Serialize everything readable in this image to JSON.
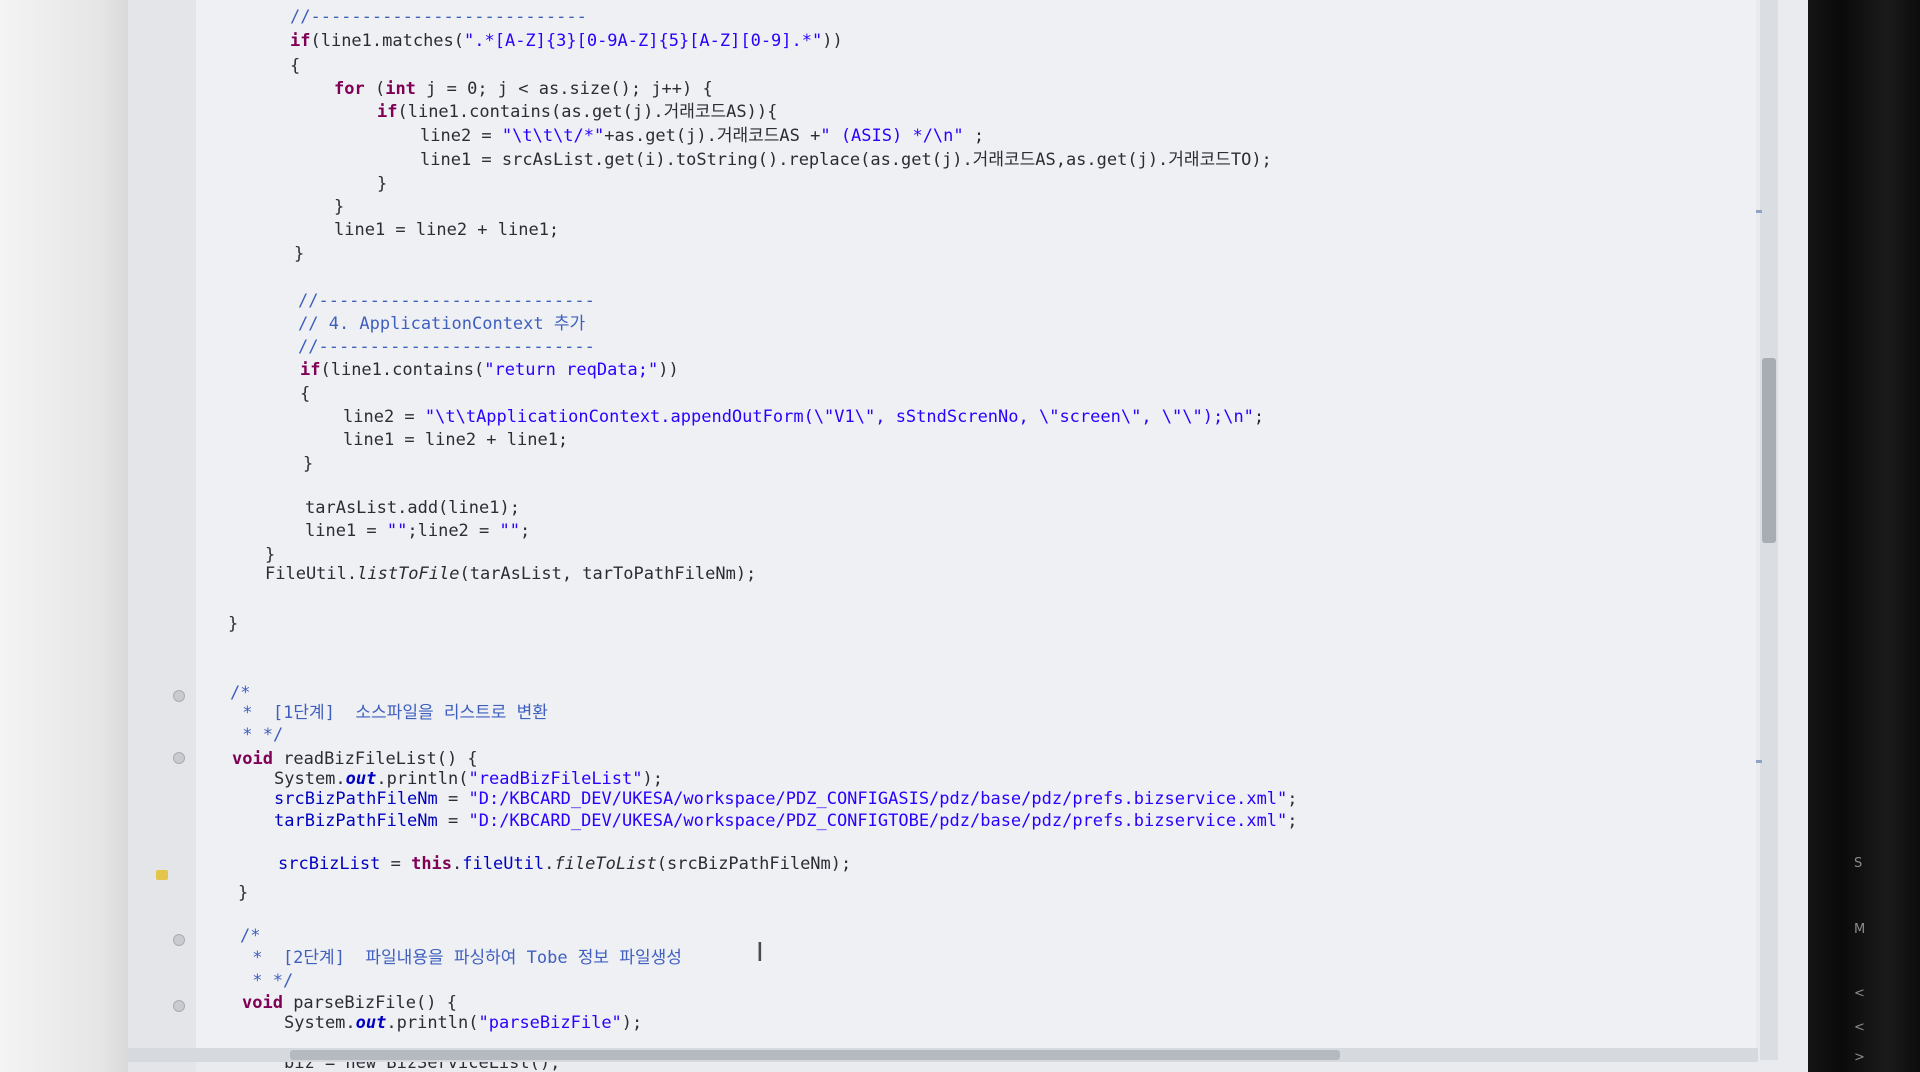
{
  "editor": {
    "lines": [
      {
        "id": "l1",
        "text": "//---------------------------"
      },
      {
        "id": "l2",
        "text": "if(line1.matches(\".*[A-Z]{3}[0-9A-Z]{5}[A-Z][0-9].*\"))"
      },
      {
        "id": "l3",
        "text": "{"
      },
      {
        "id": "l4",
        "text": "for (int j = 0; j < as.size(); j++) {"
      },
      {
        "id": "l5",
        "text": "if(line1.contains(as.get(j).거래코드AS)){"
      },
      {
        "id": "l6",
        "text": "line2 = \"\\t\\t\\t/*\"+as.get(j).거래코드AS +\" (ASIS) */\\n\" ;"
      },
      {
        "id": "l7",
        "text": "line1 = srcAsList.get(i).toString().replace(as.get(j).거래코드AS,as.get(j).거래코드TO);"
      },
      {
        "id": "l8",
        "text": "}"
      },
      {
        "id": "l9",
        "text": "}"
      },
      {
        "id": "l10",
        "text": "line1 = line2 + line1;"
      },
      {
        "id": "l11",
        "text": "}"
      },
      {
        "id": "l12",
        "text": "//---------------------------"
      },
      {
        "id": "l13",
        "text": "// 4. ApplicationContext 추가"
      },
      {
        "id": "l14",
        "text": "//---------------------------"
      },
      {
        "id": "l15",
        "text": "if(line1.contains(\"return reqData;\"))"
      },
      {
        "id": "l16",
        "text": "{"
      },
      {
        "id": "l17",
        "text": "line2 = \"\\t\\tApplicationContext.appendOutForm(\\\"V1\\\", sStndScrenNo, \\\"screen\\\", \\\"\\\");\\n\";"
      },
      {
        "id": "l18",
        "text": "line1 = line2 + line1;"
      },
      {
        "id": "l19",
        "text": "}"
      },
      {
        "id": "l20",
        "text": "tarAsList.add(line1);"
      },
      {
        "id": "l21",
        "text": "line1 = \"\";line2 = \"\";"
      },
      {
        "id": "l22",
        "text": "}"
      },
      {
        "id": "l23",
        "text": "FileUtil.listToFile(tarAsList, tarToPathFileNm);"
      },
      {
        "id": "l24",
        "text": "}"
      },
      {
        "id": "l25",
        "text": "/*"
      },
      {
        "id": "l26",
        "text": " *  [1단계]  소스파일을 리스트로 변환"
      },
      {
        "id": "l27",
        "text": " * */"
      },
      {
        "id": "l28",
        "text": "void readBizFileList() {"
      },
      {
        "id": "l29",
        "text": "System.out.println(\"readBizFileList\");"
      },
      {
        "id": "l30",
        "text": "srcBizPathFileNm = \"D:/KBCARD_DEV/UKESA/workspace/PDZ_CONFIGASIS/pdz/base/pdz/prefs.bizservice.xml\";"
      },
      {
        "id": "l31",
        "text": "tarBizPathFileNm = \"D:/KBCARD_DEV/UKESA/workspace/PDZ_CONFIGTOBE/pdz/base/pdz/prefs.bizservice.xml\";"
      },
      {
        "id": "l32",
        "text": "srcBizList = this.fileUtil.fileToList(srcBizPathFileNm);"
      },
      {
        "id": "l33",
        "text": "}"
      },
      {
        "id": "l34",
        "text": "/*"
      },
      {
        "id": "l35",
        "text": " *  [2단계]  파일내용을 파싱하여 Tobe 정보 파일생성"
      },
      {
        "id": "l36",
        "text": " * */"
      },
      {
        "id": "l37",
        "text": "void parseBizFile() {"
      },
      {
        "id": "l38",
        "text": "System.out.println(\"parseBizFile\");"
      },
      {
        "id": "l39",
        "text": "biz = new BizServiceList();"
      }
    ]
  },
  "bezel": {
    "labels": [
      "S",
      "M",
      "<",
      "<",
      ">"
    ]
  },
  "colors": {
    "keyword": "#7f0055",
    "string": "#2a00ff",
    "comment": "#3f5fbf",
    "field": "#0000c0",
    "background": "#eef0f4"
  }
}
